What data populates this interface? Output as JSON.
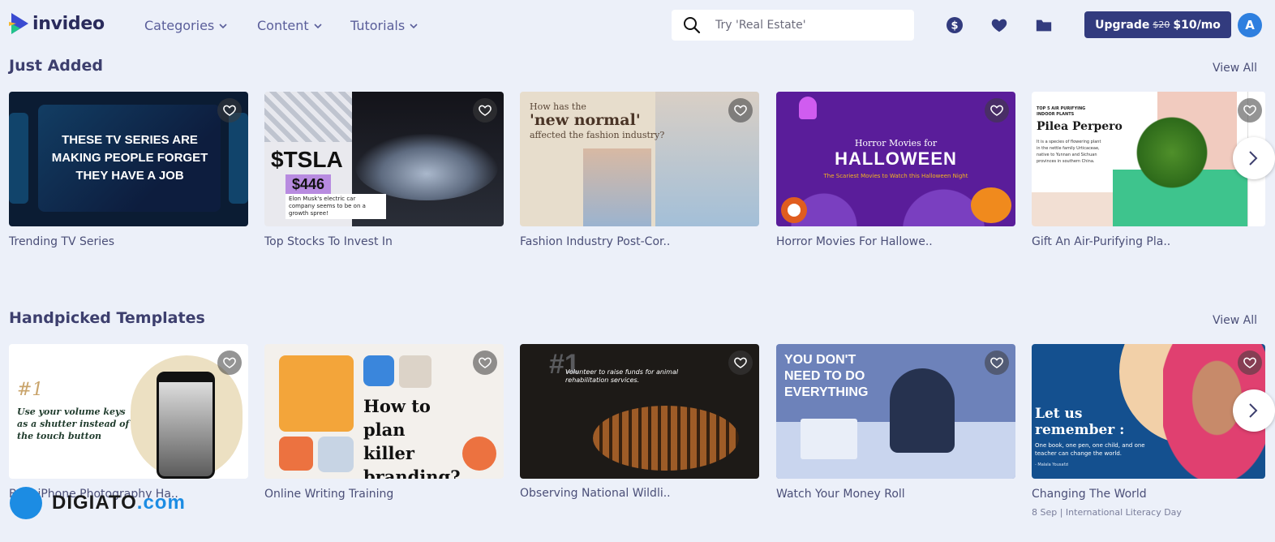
{
  "header": {
    "logo_text": "invideo",
    "nav": [
      {
        "label": "Categories"
      },
      {
        "label": "Content"
      },
      {
        "label": "Tutorials"
      }
    ],
    "search_placeholder": "Try 'Real Estate'",
    "upgrade": {
      "label": "Upgrade",
      "old_price": "$20",
      "new_price": "$10/mo"
    },
    "avatar_initial": "A"
  },
  "icons": [
    "dollar-icon",
    "heart-icon",
    "folder-icon",
    "search-icon",
    "chevron-right-icon"
  ],
  "colors": {
    "background": "#ecf0f9",
    "primary": "#323b7e",
    "avatar": "#2e7fdf"
  },
  "sections": [
    {
      "title": "Just Added",
      "view_all": "View All",
      "cards": [
        {
          "title": "Trending TV Series",
          "art_text": "THESE TV SERIES ARE MAKING PEOPLE FORGET THEY HAVE A JOB"
        },
        {
          "title": "Top Stocks To Invest In",
          "art_ticker": "$TSLA",
          "art_price": "$446",
          "art_note": "Elon Musk's electric car company seems to be on a growth spree!"
        },
        {
          "title": "Fashion Industry Post-Cor..",
          "art_q1": "How has the",
          "art_q2": "'new normal'",
          "art_q3": "affected the fashion industry?"
        },
        {
          "title": "Horror Movies For Hallowe..",
          "art_t1": "Horror Movies for",
          "art_t2": "HALLOWEEN",
          "art_t3": "The Scariest Movies to Watch this Halloween Night"
        },
        {
          "title": "Gift An Air-Purifying Pla..",
          "art_l1": "TOP 5 AIR PURIFYING",
          "art_l2": "INDOOR PLANTS",
          "art_l3": "Pilea Perpero",
          "art_l4": "It is a species of flowering plant in the nettle family Urticaceae, native to Yunnan and Sichuan provinces in southern China."
        }
      ]
    },
    {
      "title": "Handpicked Templates",
      "view_all": "View All",
      "cards": [
        {
          "title": "Best iPhone Photography Ha..",
          "art_n1": "#1",
          "art_n2": "Use your volume keys as a shutter instead of the touch button"
        },
        {
          "title": "Online Writing Training",
          "art_head": "How to plan killer branding?"
        },
        {
          "title": "Observing National Wildli..",
          "art_num": "#1",
          "art_cap": "Volunteer to raise funds for animal rehabilitation services."
        },
        {
          "title": "Watch Your Money Roll",
          "art_text": "YOU DON'T NEED TO DO EVERYTHING"
        },
        {
          "title": "Changing The World",
          "subtitle": "8 Sep | International Literacy Day",
          "art_h": "Let us remember :",
          "art_b": "One book, one pen, one child, and one teacher can change the world.",
          "art_s": "- Malala Yousafzi"
        }
      ]
    }
  ],
  "watermark": {
    "name": "DIGIATO",
    "domain": ".com"
  }
}
